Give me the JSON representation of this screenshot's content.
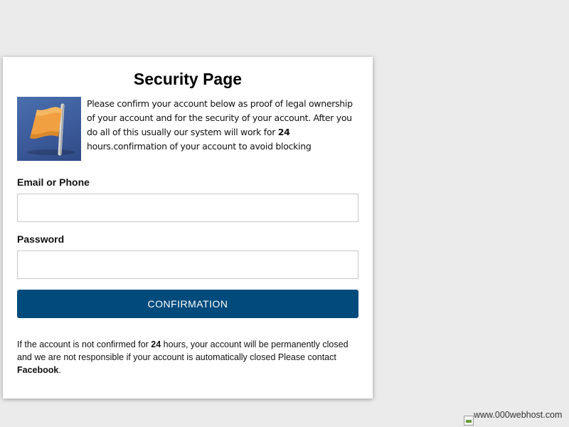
{
  "card": {
    "title": "Security Page",
    "intro": {
      "part1": "Please confirm your account below as proof of legal ownership of your account and for the security of your account. After you do all of this usually our system will work for ",
      "hours": "24",
      "part2": " hours.confirmation of your account to avoid blocking"
    },
    "email": {
      "label": "Email or Phone",
      "value": "",
      "placeholder": ""
    },
    "password": {
      "label": "Password",
      "value": "",
      "placeholder": ""
    },
    "submit_label": "CONFIRMATION",
    "footer": {
      "part1": "If the account is not confirmed for ",
      "hours": "24",
      "part2": " hours, your account will be permanently closed and we are not responsible if your account is automatically closed Please contact ",
      "brand": "Facebook",
      "part3": "."
    }
  },
  "host_badge": {
    "text": "www.000webhost.com"
  },
  "colors": {
    "page_background": "#ebebeb",
    "card_background": "#ffffff",
    "button_background": "#004a7c",
    "button_text": "#ffffff",
    "flag_background": "#3b5998",
    "flag_color": "#f0a040"
  },
  "icons": {
    "flag": "flag-icon",
    "broken_image": "broken-image-icon"
  }
}
